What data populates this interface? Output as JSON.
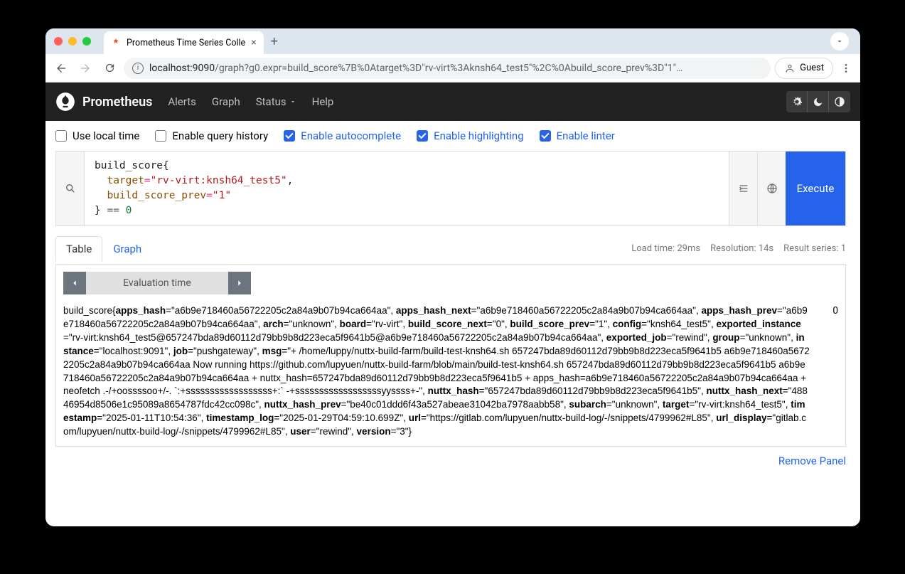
{
  "browser": {
    "tab_title": "Prometheus Time Series Colle",
    "url_host": "localhost:9090",
    "url_path": "/graph?g0.expr=build_score%7B%0Atarget%3D\"rv-virt%3Aknsh64_test5\"%2C%0Abuild_score_prev%3D\"1\"…",
    "guest": "Guest"
  },
  "nav": {
    "brand": "Prometheus",
    "links": [
      "Alerts",
      "Graph",
      "Status",
      "Help"
    ]
  },
  "options": {
    "local_time": {
      "label": "Use local time",
      "checked": false
    },
    "query_history": {
      "label": "Enable query history",
      "checked": false
    },
    "autocomplete": {
      "label": "Enable autocomplete",
      "checked": true
    },
    "highlighting": {
      "label": "Enable highlighting",
      "checked": true
    },
    "linter": {
      "label": "Enable linter",
      "checked": true
    }
  },
  "query": {
    "fn": "build_score",
    "key1": "target",
    "val1": "\"rv-virt:knsh64_test5\"",
    "key2": "build_score_prev",
    "val2": "\"1\"",
    "cmp_num": "0",
    "execute": "Execute"
  },
  "tabs": {
    "table": "Table",
    "graph": "Graph"
  },
  "stats": {
    "load": "Load time: 29ms",
    "res": "Resolution: 14s",
    "series": "Result series: 1"
  },
  "eval": {
    "label": "Evaluation time"
  },
  "result": {
    "value": "0",
    "metric_name": "build_score",
    "labels": [
      {
        "k": "apps_hash",
        "v": "\"a6b9e718460a56722205c2a84a9b07b94ca664aa\""
      },
      {
        "k": "apps_hash_next",
        "v": "\"a6b9e718460a56722205c2a84a9b07b94ca664aa\""
      },
      {
        "k": "apps_hash_prev",
        "v": "\"a6b9e718460a56722205c2a84a9b07b94ca664aa\""
      },
      {
        "k": "arch",
        "v": "\"unknown\""
      },
      {
        "k": "board",
        "v": "\"rv-virt\""
      },
      {
        "k": "build_score_next",
        "v": "\"0\""
      },
      {
        "k": "build_score_prev",
        "v": "\"1\""
      },
      {
        "k": "config",
        "v": "\"knsh64_test5\""
      },
      {
        "k": "exported_instance",
        "v": "\"rv-virt:knsh64_test5@657247bda89d60112d79bb9b8d223eca5f9641b5@a6b9e718460a56722205c2a84a9b07b94ca664aa\""
      },
      {
        "k": "exported_job",
        "v": "\"rewind\""
      },
      {
        "k": "group",
        "v": "\"unknown\""
      },
      {
        "k": "instance",
        "v": "\"localhost:9091\""
      },
      {
        "k": "job",
        "v": "\"pushgateway\""
      },
      {
        "k": "msg",
        "v": "\"+ /home/luppy/nuttx-build-farm/build-test-knsh64.sh 657247bda89d60112d79bb9b8d223eca5f9641b5 a6b9e718460a56722205c2a84a9b07b94ca664aa Now running https://github.com/lupyuen/nuttx-build-farm/blob/main/build-test-knsh64.sh 657247bda89d60112d79bb9b8d223eca5f9641b5 a6b9e718460a56722205c2a84a9b07b94ca664aa + nuttx_hash=657247bda89d60112d79bb9b8d223eca5f9641b5 + apps_hash=a6b9e718460a56722205c2a84a9b07b94ca664aa + neofetch .-/+oossssoo+/-. `:+ssssssssssssssssss+:` -+ssssssssssssssssssyyssss+-\""
      },
      {
        "k": "nuttx_hash",
        "v": "\"657247bda89d60112d79bb9b8d223eca5f9641b5\""
      },
      {
        "k": "nuttx_hash_next",
        "v": "\"48846954d8506e1c95089a8654787fdc42cc098c\""
      },
      {
        "k": "nuttx_hash_prev",
        "v": "\"be40c01ddd6f43a527abeae31042ba7978aabb58\""
      },
      {
        "k": "subarch",
        "v": "\"unknown\""
      },
      {
        "k": "target",
        "v": "\"rv-virt:knsh64_test5\""
      },
      {
        "k": "timestamp",
        "v": "\"2025-01-11T10:54:36\""
      },
      {
        "k": "timestamp_log",
        "v": "\"2025-01-29T04:59:10.699Z\""
      },
      {
        "k": "url",
        "v": "\"https://gitlab.com/lupyuen/nuttx-build-log/-/snippets/4799962#L85\""
      },
      {
        "k": "url_display",
        "v": "\"gitlab.com/lupyuen/nuttx-build-log/-/snippets/4799962#L85\""
      },
      {
        "k": "user",
        "v": "\"rewind\""
      },
      {
        "k": "version",
        "v": "\"3\""
      }
    ]
  },
  "remove": "Remove Panel"
}
